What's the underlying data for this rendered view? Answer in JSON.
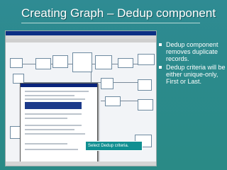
{
  "slide": {
    "title": "Creating Graph – Dedup component",
    "bullets": [
      "Dedup component removes duplicate records.",
      "Dedup criteria will be either unique-only, First or Last."
    ]
  },
  "screenshot": {
    "callout": "Select Dedup criteria."
  },
  "colors": {
    "background": "#2a8a8c",
    "title_text": "#ffffff",
    "bullet_text": "#ffffff",
    "callout_bg": "#118f91"
  }
}
